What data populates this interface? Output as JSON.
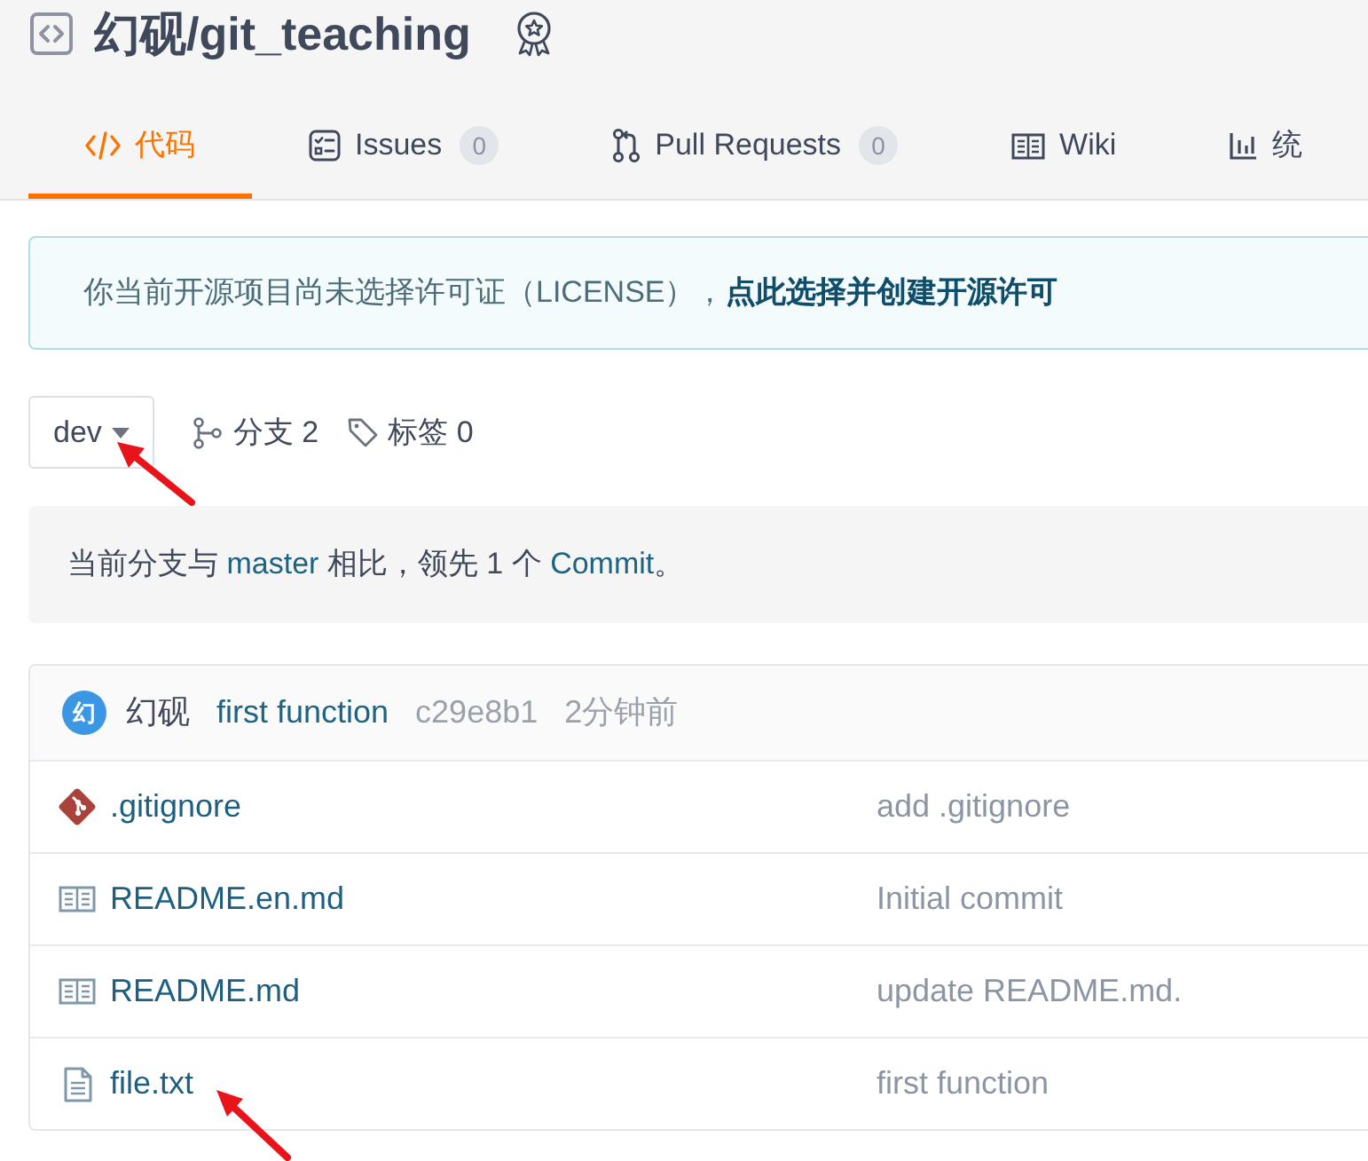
{
  "repo": {
    "title": "幻砚/git_teaching"
  },
  "tabs": [
    {
      "kind": "code",
      "label": "代码",
      "selected": true
    },
    {
      "kind": "issues",
      "label": "Issues",
      "count": "0",
      "selected": false
    },
    {
      "kind": "pulls",
      "label": "Pull Requests",
      "count": "0",
      "selected": false
    },
    {
      "kind": "wiki",
      "label": "Wiki",
      "selected": false
    },
    {
      "kind": "stats",
      "label": "统",
      "selected": false
    }
  ],
  "license_notice": {
    "text": "你当前开源项目尚未选择许可证（LICENSE），",
    "link": "点此选择并创建开源许可"
  },
  "branch_bar": {
    "branch": "dev",
    "branches": "分支 2",
    "tags": "标签 0"
  },
  "compare_notice": {
    "parts": [
      {
        "kind": "plain",
        "text": "当前分支与 "
      },
      {
        "kind": "branch",
        "text": "master"
      },
      {
        "kind": "plain",
        "text": " 相比，领先 1 个 "
      },
      {
        "kind": "commit",
        "text": "Commit"
      },
      {
        "kind": "plain",
        "text": "。"
      }
    ]
  },
  "last_commit": {
    "avatar": "幻",
    "author": "幻砚",
    "message": "first function",
    "hash": "c29e8b1",
    "time": "2分钟前"
  },
  "files": [
    {
      "kind": "git",
      "name": ".gitignore",
      "commit": "add .gitignore"
    },
    {
      "kind": "readme",
      "name": "README.en.md",
      "commit": "Initial commit"
    },
    {
      "kind": "readme",
      "name": "README.md",
      "commit": "update README.md."
    },
    {
      "kind": "text",
      "name": "file.txt",
      "commit": "first function"
    }
  ]
}
